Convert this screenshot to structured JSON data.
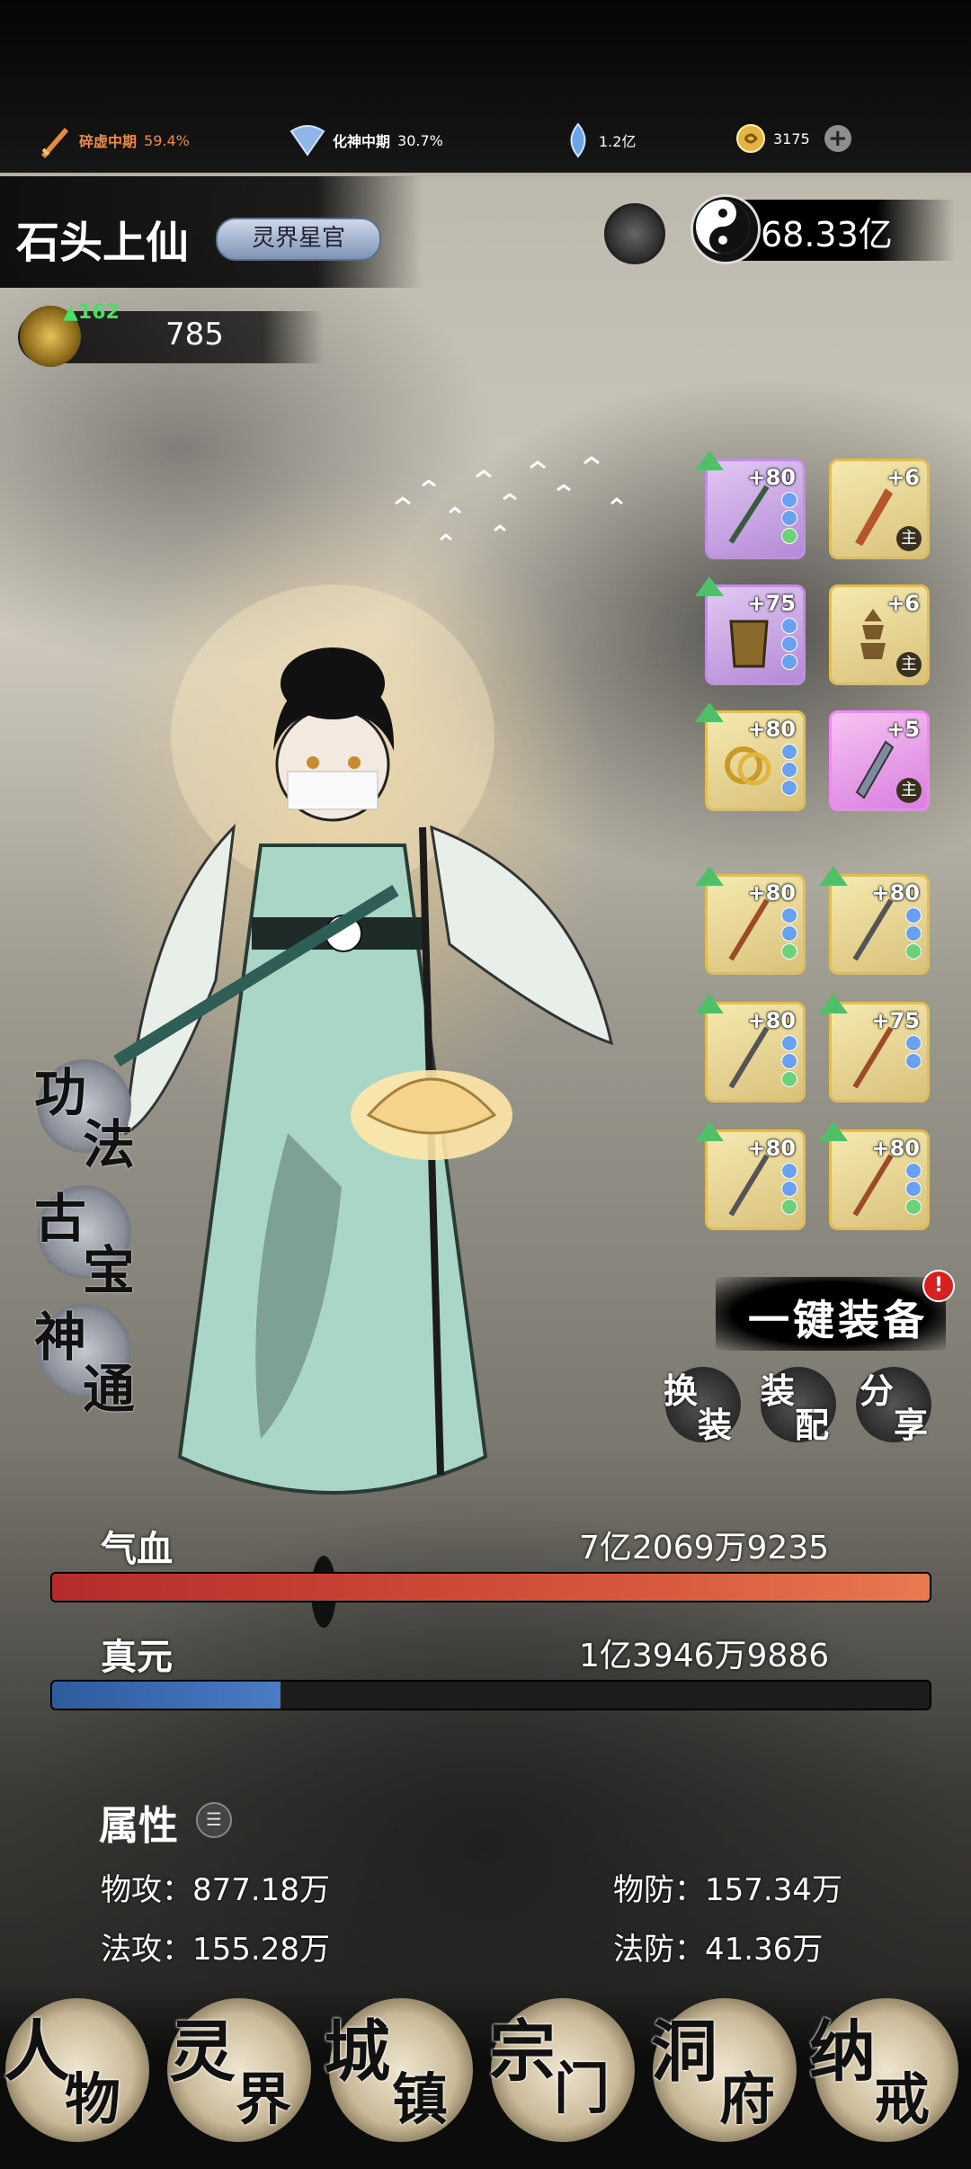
{
  "topbar": {
    "realm1": {
      "label": "碎虚中期",
      "percent": "59.4%",
      "color": "#f08a3c"
    },
    "realm2": {
      "label": "化神中期",
      "percent": "30.7%"
    },
    "spirit_stone": "1.2亿",
    "gold": "3175"
  },
  "player": {
    "name": "石头上仙",
    "title_badge": "灵界星官",
    "yinyang_value": "68.33亿",
    "power_up": "162",
    "power": "785"
  },
  "equipment": [
    {
      "level": "+80",
      "rarity": "purple",
      "main": false
    },
    {
      "level": "+6",
      "rarity": "gold",
      "main": true,
      "main_label": "主"
    },
    {
      "level": "+75",
      "rarity": "purple",
      "main": false
    },
    {
      "level": "+6",
      "rarity": "gold",
      "main": true,
      "main_label": "主"
    },
    {
      "level": "+80",
      "rarity": "gold",
      "main": false
    },
    {
      "level": "+5",
      "rarity": "pink",
      "main": true,
      "main_label": "主"
    },
    {
      "level": "+80",
      "rarity": "gold",
      "main": false
    },
    {
      "level": "+80",
      "rarity": "gold",
      "main": false
    },
    {
      "level": "+80",
      "rarity": "gold",
      "main": false
    },
    {
      "level": "+75",
      "rarity": "gold",
      "main": false
    },
    {
      "level": "+80",
      "rarity": "gold",
      "main": false
    },
    {
      "level": "+80",
      "rarity": "gold",
      "main": false
    }
  ],
  "side_menu": {
    "gongfa": [
      "功",
      "法"
    ],
    "gubao": [
      "古",
      "宝"
    ],
    "shentong": [
      "神",
      "通"
    ]
  },
  "actions": {
    "one_key_equip": "一键装备",
    "notice": "!",
    "change": [
      "换",
      "装"
    ],
    "match": [
      "装",
      "配"
    ],
    "share": [
      "分",
      "享"
    ]
  },
  "stats": {
    "hp_label": "气血",
    "hp_value": "7亿2069万9235",
    "hp_fill": 1.0,
    "mp_label": "真元",
    "mp_value": "1亿3946万9886",
    "mp_fill": 0.26
  },
  "attributes": {
    "title": "属性",
    "phys_atk": "物攻：877.18万",
    "phys_def": "物防：157.34万",
    "mag_atk": "法攻：155.28万",
    "mag_def": "法防：41.36万"
  },
  "nav": {
    "character": [
      "人",
      "物"
    ],
    "spirit_realm": [
      "灵",
      "界"
    ],
    "town": [
      "城",
      "镇"
    ],
    "sect": [
      "宗",
      "门"
    ],
    "cave": [
      "洞",
      "府"
    ],
    "storage": [
      "纳",
      "戒"
    ]
  }
}
